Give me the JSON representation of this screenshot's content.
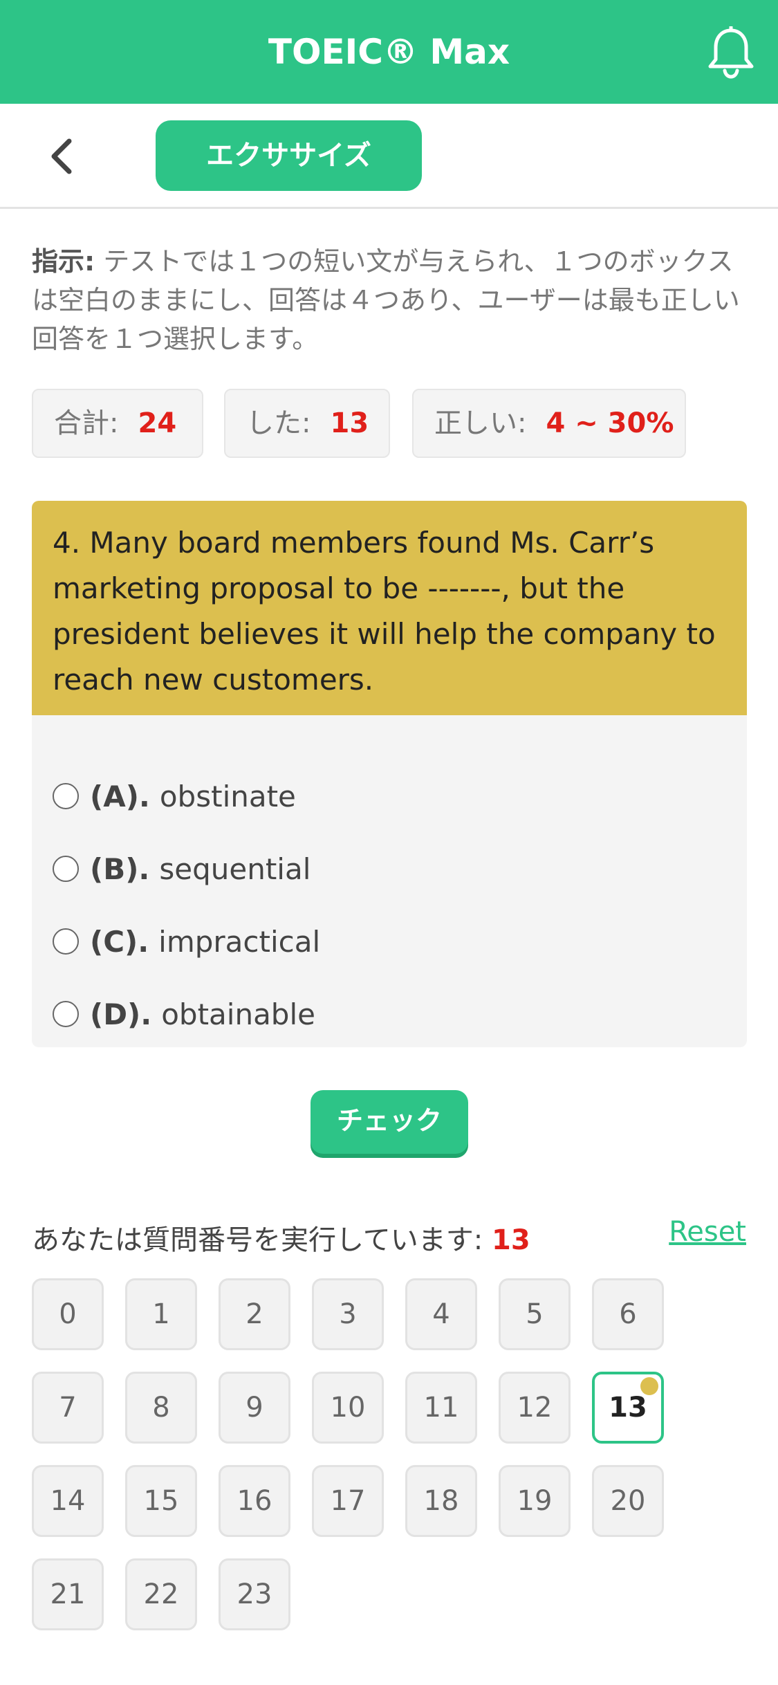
{
  "colors": {
    "primary": "#2dc487",
    "question_bg": "#dcbf4f",
    "highlight": "#e0201a"
  },
  "header": {
    "title": "TOEIC® Max",
    "bell_icon": "bell-icon"
  },
  "subheader": {
    "back_icon": "chevron-left-icon",
    "exercise_label": "エクササイズ"
  },
  "instructions": {
    "label": "指示:",
    "text": " テストでは１つの短い文が与えられ、１つのボックスは空白のままにし、回答は４つあり、ユーザーは最も正しい回答を１つ選択します。"
  },
  "stats": {
    "total_label": "合計:",
    "total_value": "24",
    "done_label": "した:",
    "done_value": "13",
    "correct_label": "正しい:",
    "correct_value": "4 ~ 30%"
  },
  "question": {
    "text": "4. Many board members found Ms. Carr’s marketing proposal to be -------, but the president believes it will help the company to reach new customers.",
    "options": [
      {
        "key": "(A).",
        "text": "obstinate"
      },
      {
        "key": "(B).",
        "text": "sequential"
      },
      {
        "key": "(C).",
        "text": "impractical"
      },
      {
        "key": "(D).",
        "text": "obtainable"
      }
    ]
  },
  "check_label": "チェック",
  "progress": {
    "label": "あなたは質問番号を実行しています:",
    "current": "13",
    "reset_label": "Reset"
  },
  "question_numbers": [
    "0",
    "1",
    "2",
    "3",
    "4",
    "5",
    "6",
    "7",
    "8",
    "9",
    "10",
    "11",
    "12",
    "13",
    "14",
    "15",
    "16",
    "17",
    "18",
    "19",
    "20",
    "21",
    "22",
    "23"
  ]
}
